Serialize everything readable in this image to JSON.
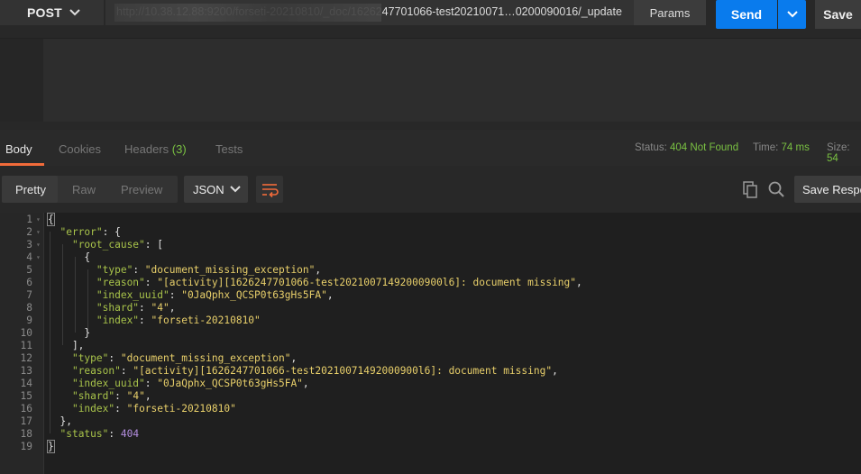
{
  "request": {
    "method": "POST",
    "url": "http://10.38.12.88:9200/forseti-20210810/_doc/1626247701066-test20210071…0200090016/_update",
    "params_label": "Params",
    "send_label": "Send",
    "save_label": "Save"
  },
  "response_tabs": [
    {
      "label": "Body",
      "active": true
    },
    {
      "label": "Cookies"
    },
    {
      "label": "Headers",
      "count": "(3)"
    },
    {
      "label": "Tests"
    }
  ],
  "status": {
    "status_label": "Status:",
    "status_value": "404 Not Found",
    "time_label": "Time:",
    "time_value": "74 ms",
    "size_label": "Size:",
    "size_value": "54"
  },
  "view": {
    "modes": [
      "Pretty",
      "Raw",
      "Preview"
    ],
    "active_mode": "Pretty",
    "format": "JSON",
    "save_response_label": "Save Response"
  },
  "icons": [
    "chevron-down-icon",
    "wrap-lines-icon",
    "copy-icon",
    "search-icon"
  ],
  "colors": {
    "accent": "#f26b3a",
    "send": "#097bed",
    "status_ok": "#7ac142"
  },
  "body_lines": [
    [
      {
        "t": "{",
        "c": "p"
      }
    ],
    [
      {
        "t": "  "
      },
      {
        "t": "\"error\"",
        "c": "k"
      },
      {
        "t": ": {",
        "c": "p"
      }
    ],
    [
      {
        "t": "    "
      },
      {
        "t": "\"root_cause\"",
        "c": "k"
      },
      {
        "t": ": [",
        "c": "p"
      }
    ],
    [
      {
        "t": "      {",
        "c": "p"
      }
    ],
    [
      {
        "t": "        "
      },
      {
        "t": "\"type\"",
        "c": "k"
      },
      {
        "t": ": ",
        "c": "p"
      },
      {
        "t": "\"document_missing_exception\"",
        "c": "s"
      },
      {
        "t": ",",
        "c": "p"
      }
    ],
    [
      {
        "t": "        "
      },
      {
        "t": "\"reason\"",
        "c": "k"
      },
      {
        "t": ": ",
        "c": "p"
      },
      {
        "t": "\"[activity][1626247701066-test20210071492000900l6]: document missing\"",
        "c": "s"
      },
      {
        "t": ",",
        "c": "p"
      }
    ],
    [
      {
        "t": "        "
      },
      {
        "t": "\"index_uuid\"",
        "c": "k"
      },
      {
        "t": ": ",
        "c": "p"
      },
      {
        "t": "\"0JaQphx_QCSP0t63gHs5FA\"",
        "c": "s"
      },
      {
        "t": ",",
        "c": "p"
      }
    ],
    [
      {
        "t": "        "
      },
      {
        "t": "\"shard\"",
        "c": "k"
      },
      {
        "t": ": ",
        "c": "p"
      },
      {
        "t": "\"4\"",
        "c": "s"
      },
      {
        "t": ",",
        "c": "p"
      }
    ],
    [
      {
        "t": "        "
      },
      {
        "t": "\"index\"",
        "c": "k"
      },
      {
        "t": ": ",
        "c": "p"
      },
      {
        "t": "\"forseti-20210810\"",
        "c": "s"
      }
    ],
    [
      {
        "t": "      }",
        "c": "p"
      }
    ],
    [
      {
        "t": "    ],",
        "c": "p"
      }
    ],
    [
      {
        "t": "    "
      },
      {
        "t": "\"type\"",
        "c": "k"
      },
      {
        "t": ": ",
        "c": "p"
      },
      {
        "t": "\"document_missing_exception\"",
        "c": "s"
      },
      {
        "t": ",",
        "c": "p"
      }
    ],
    [
      {
        "t": "    "
      },
      {
        "t": "\"reason\"",
        "c": "k"
      },
      {
        "t": ": ",
        "c": "p"
      },
      {
        "t": "\"[activity][1626247701066-test20210071492000900l6]: document missing\"",
        "c": "s"
      },
      {
        "t": ",",
        "c": "p"
      }
    ],
    [
      {
        "t": "    "
      },
      {
        "t": "\"index_uuid\"",
        "c": "k"
      },
      {
        "t": ": ",
        "c": "p"
      },
      {
        "t": "\"0JaQphx_QCSP0t63gHs5FA\"",
        "c": "s"
      },
      {
        "t": ",",
        "c": "p"
      }
    ],
    [
      {
        "t": "    "
      },
      {
        "t": "\"shard\"",
        "c": "k"
      },
      {
        "t": ": ",
        "c": "p"
      },
      {
        "t": "\"4\"",
        "c": "s"
      },
      {
        "t": ",",
        "c": "p"
      }
    ],
    [
      {
        "t": "    "
      },
      {
        "t": "\"index\"",
        "c": "k"
      },
      {
        "t": ": ",
        "c": "p"
      },
      {
        "t": "\"forseti-20210810\"",
        "c": "s"
      }
    ],
    [
      {
        "t": "  },",
        "c": "p"
      }
    ],
    [
      {
        "t": "  "
      },
      {
        "t": "\"status\"",
        "c": "k"
      },
      {
        "t": ": ",
        "c": "p"
      },
      {
        "t": "404",
        "c": "n"
      }
    ],
    [
      {
        "t": "}",
        "c": "p"
      }
    ]
  ],
  "foldable_lines": [
    1,
    2,
    3,
    4
  ]
}
